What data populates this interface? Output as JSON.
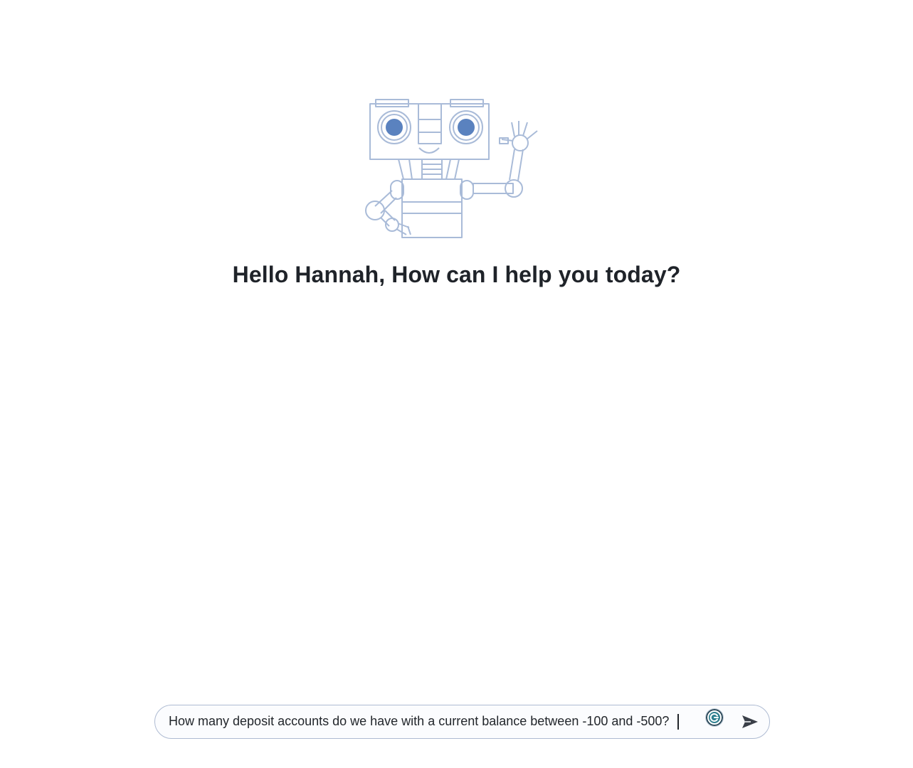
{
  "greeting": {
    "text": "Hello Hannah, How can I help you today?"
  },
  "composer": {
    "value": "How many deposit accounts do we have with a current balance between -100 and -500?",
    "grammar_icon": "grammar-assistant-icon",
    "send_icon": "send-arrow-icon"
  },
  "mascot": {
    "icon": "waving-robot-illustration"
  },
  "colors": {
    "robot_stroke": "#a9bbd8",
    "robot_eye": "#5a82bf",
    "text": "#1f2329",
    "input_border": "#aebbd2",
    "send_icon": "#3a3f48"
  }
}
